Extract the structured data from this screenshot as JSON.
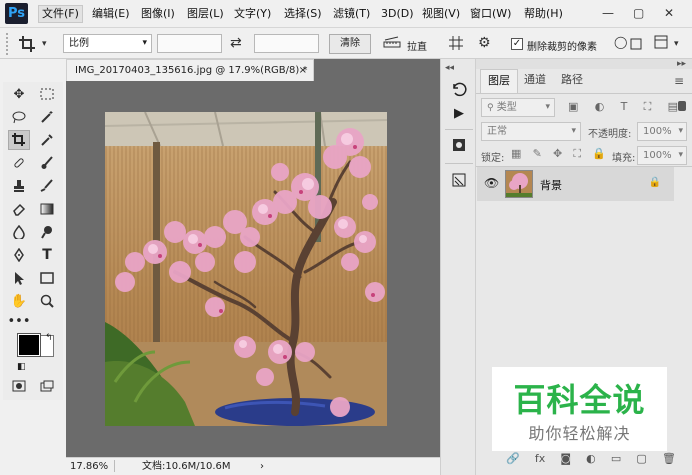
{
  "app": {
    "logo": "Ps"
  },
  "menu": [
    "文件(F)",
    "编辑(E)",
    "图像(I)",
    "图层(L)",
    "文字(Y)",
    "选择(S)",
    "滤镜(T)",
    "3D(D)",
    "视图(V)",
    "窗口(W)",
    "帮助(H)"
  ],
  "window_controls": {
    "minimize": "—",
    "restore": "▢",
    "close": "✕"
  },
  "options": {
    "ratio_select": "比例",
    "swap_icon": "⇄",
    "clear_button": "清除",
    "straighten_label": "拉直",
    "delete_cropped_label": "删除裁剪的像素",
    "delete_cropped_checked": true
  },
  "document": {
    "tab_title": "IMG_20170403_135616.jpg @ 17.9%(RGB/8) *",
    "close": "×"
  },
  "status": {
    "zoom": "17.86%",
    "doc_info": "文档:10.6M/10.6M",
    "arrow": "›"
  },
  "panel": {
    "tabs": [
      "图层",
      "通道",
      "路径"
    ],
    "filter_kind": "类型",
    "blend_mode": "正常",
    "opacity_label": "不透明度:",
    "opacity_value": "100%",
    "lock_label": "锁定:",
    "fill_label": "填充:",
    "fill_value": "100%",
    "layer_name": "背景",
    "bottom_icons": [
      "🔗",
      "fx",
      "◙",
      "◐",
      "▭",
      "▢",
      "🗑"
    ]
  },
  "watermark": {
    "title": "百科全说",
    "subtitle": "助你轻松解决"
  },
  "colors": {
    "accent_green": "#2bb34a",
    "ps_blue": "#2fa3f6",
    "foreground": "#000000",
    "background": "#ffffff"
  }
}
